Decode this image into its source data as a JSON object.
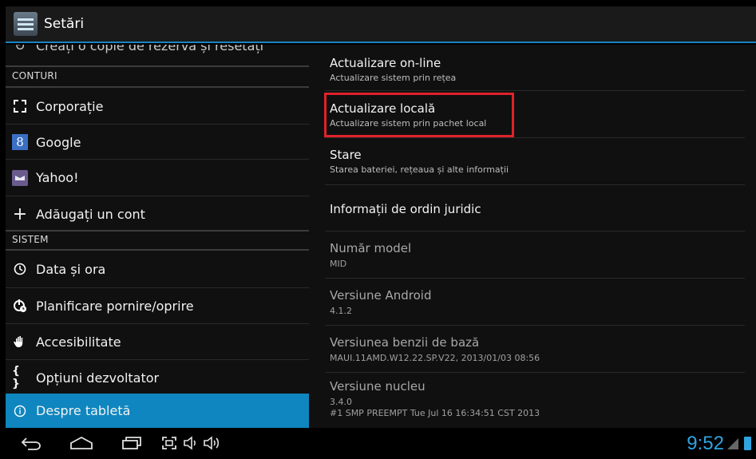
{
  "app_title": "Setări",
  "left": {
    "partial_item": "Creați o copie de rezervă și resetați",
    "accounts_header": "CONTURI",
    "accounts": [
      {
        "label": "Corporație",
        "icon": "corporate-icon"
      },
      {
        "label": "Google",
        "icon": "google-icon"
      },
      {
        "label": "Yahoo!",
        "icon": "yahoo-icon"
      },
      {
        "label": "Adăugați un cont",
        "icon": "plus-icon"
      }
    ],
    "system_header": "SISTEM",
    "system": [
      {
        "label": "Data și ora",
        "icon": "clock-icon"
      },
      {
        "label": "Planificare pornire/oprire",
        "icon": "power-schedule-icon"
      },
      {
        "label": "Accesibilitate",
        "icon": "hand-icon"
      },
      {
        "label": "Opțiuni dezvoltator",
        "icon": "braces-icon"
      },
      {
        "label": "Despre tabletă",
        "icon": "info-icon"
      }
    ]
  },
  "right": {
    "items": [
      {
        "title": "Actualizare on-line",
        "summary": "Actualizare sistem prin rețea"
      },
      {
        "title": "Actualizare locală",
        "summary": "Actualizare sistem prin pachet local"
      },
      {
        "title": "Stare",
        "summary": "Starea bateriei, rețeaua și alte informații"
      },
      {
        "title": "Informații de ordin juridic",
        "summary": ""
      },
      {
        "title": "Număr model",
        "summary": "MID"
      },
      {
        "title": "Versiune Android",
        "summary": "4.1.2"
      },
      {
        "title": "Versiunea benzii de bază",
        "summary": "MAUI.11AMD.W12.22.SP.V22, 2013/01/03 08:56"
      },
      {
        "title": "Versiune nucleu",
        "summary": "3.4.0",
        "summary2": "#1 SMP PREEMPT Tue Jul 16 16:34:51 CST 2013"
      }
    ]
  },
  "status": {
    "time": "9:52"
  },
  "colors": {
    "accent": "#0f86bf",
    "clock": "#2ea3e0",
    "highlight": "#e0222a"
  }
}
